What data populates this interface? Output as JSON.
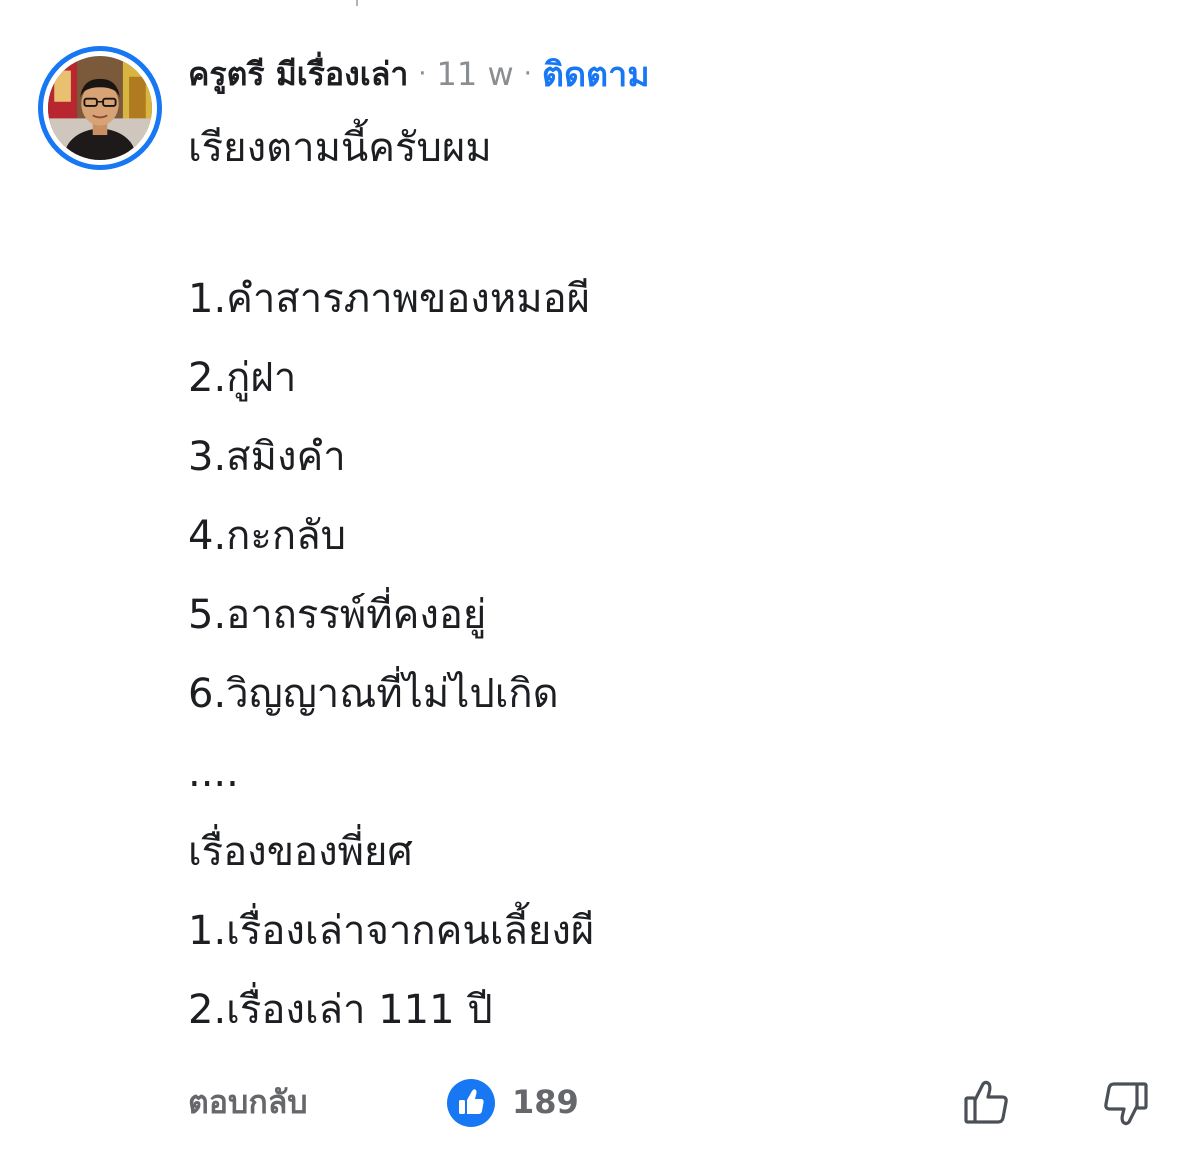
{
  "comment": {
    "author": {
      "name": "ครูตรี มีเรื่องเล่า",
      "avatar_icon": "profile-photo"
    },
    "separator": "·",
    "timestamp": "11 w",
    "follow_label": "ติดตาม",
    "body": {
      "intro": "เรียงตามนี้ครับผม",
      "list_one": [
        "1.คำสารภาพของหมอผี",
        "2.กู่ฝา",
        "3.สมิงคำ",
        "4.กะกลับ",
        "5.อาถรรพ์ที่คงอยู่",
        "6.วิญญาณที่ไม่ไปเกิด"
      ],
      "ellipsis": "....",
      "subheading": "เรื่องของพี่ยศ",
      "list_two": [
        "1.เรื่องเล่าจากคนเลี้ยงผี",
        "2.เรื่องเล่า 111 ปี"
      ]
    },
    "actions": {
      "reply_label": "ตอบกลับ",
      "reaction_icon": "like-reaction-icon",
      "reaction_count": "189",
      "upvote_icon": "thumbs-up-outline-icon",
      "downvote_icon": "thumbs-down-outline-icon"
    }
  },
  "colors": {
    "accent_blue": "#1877f2",
    "text_primary": "#1c1e21",
    "text_secondary": "#65676b",
    "text_muted": "#8a8d91"
  }
}
